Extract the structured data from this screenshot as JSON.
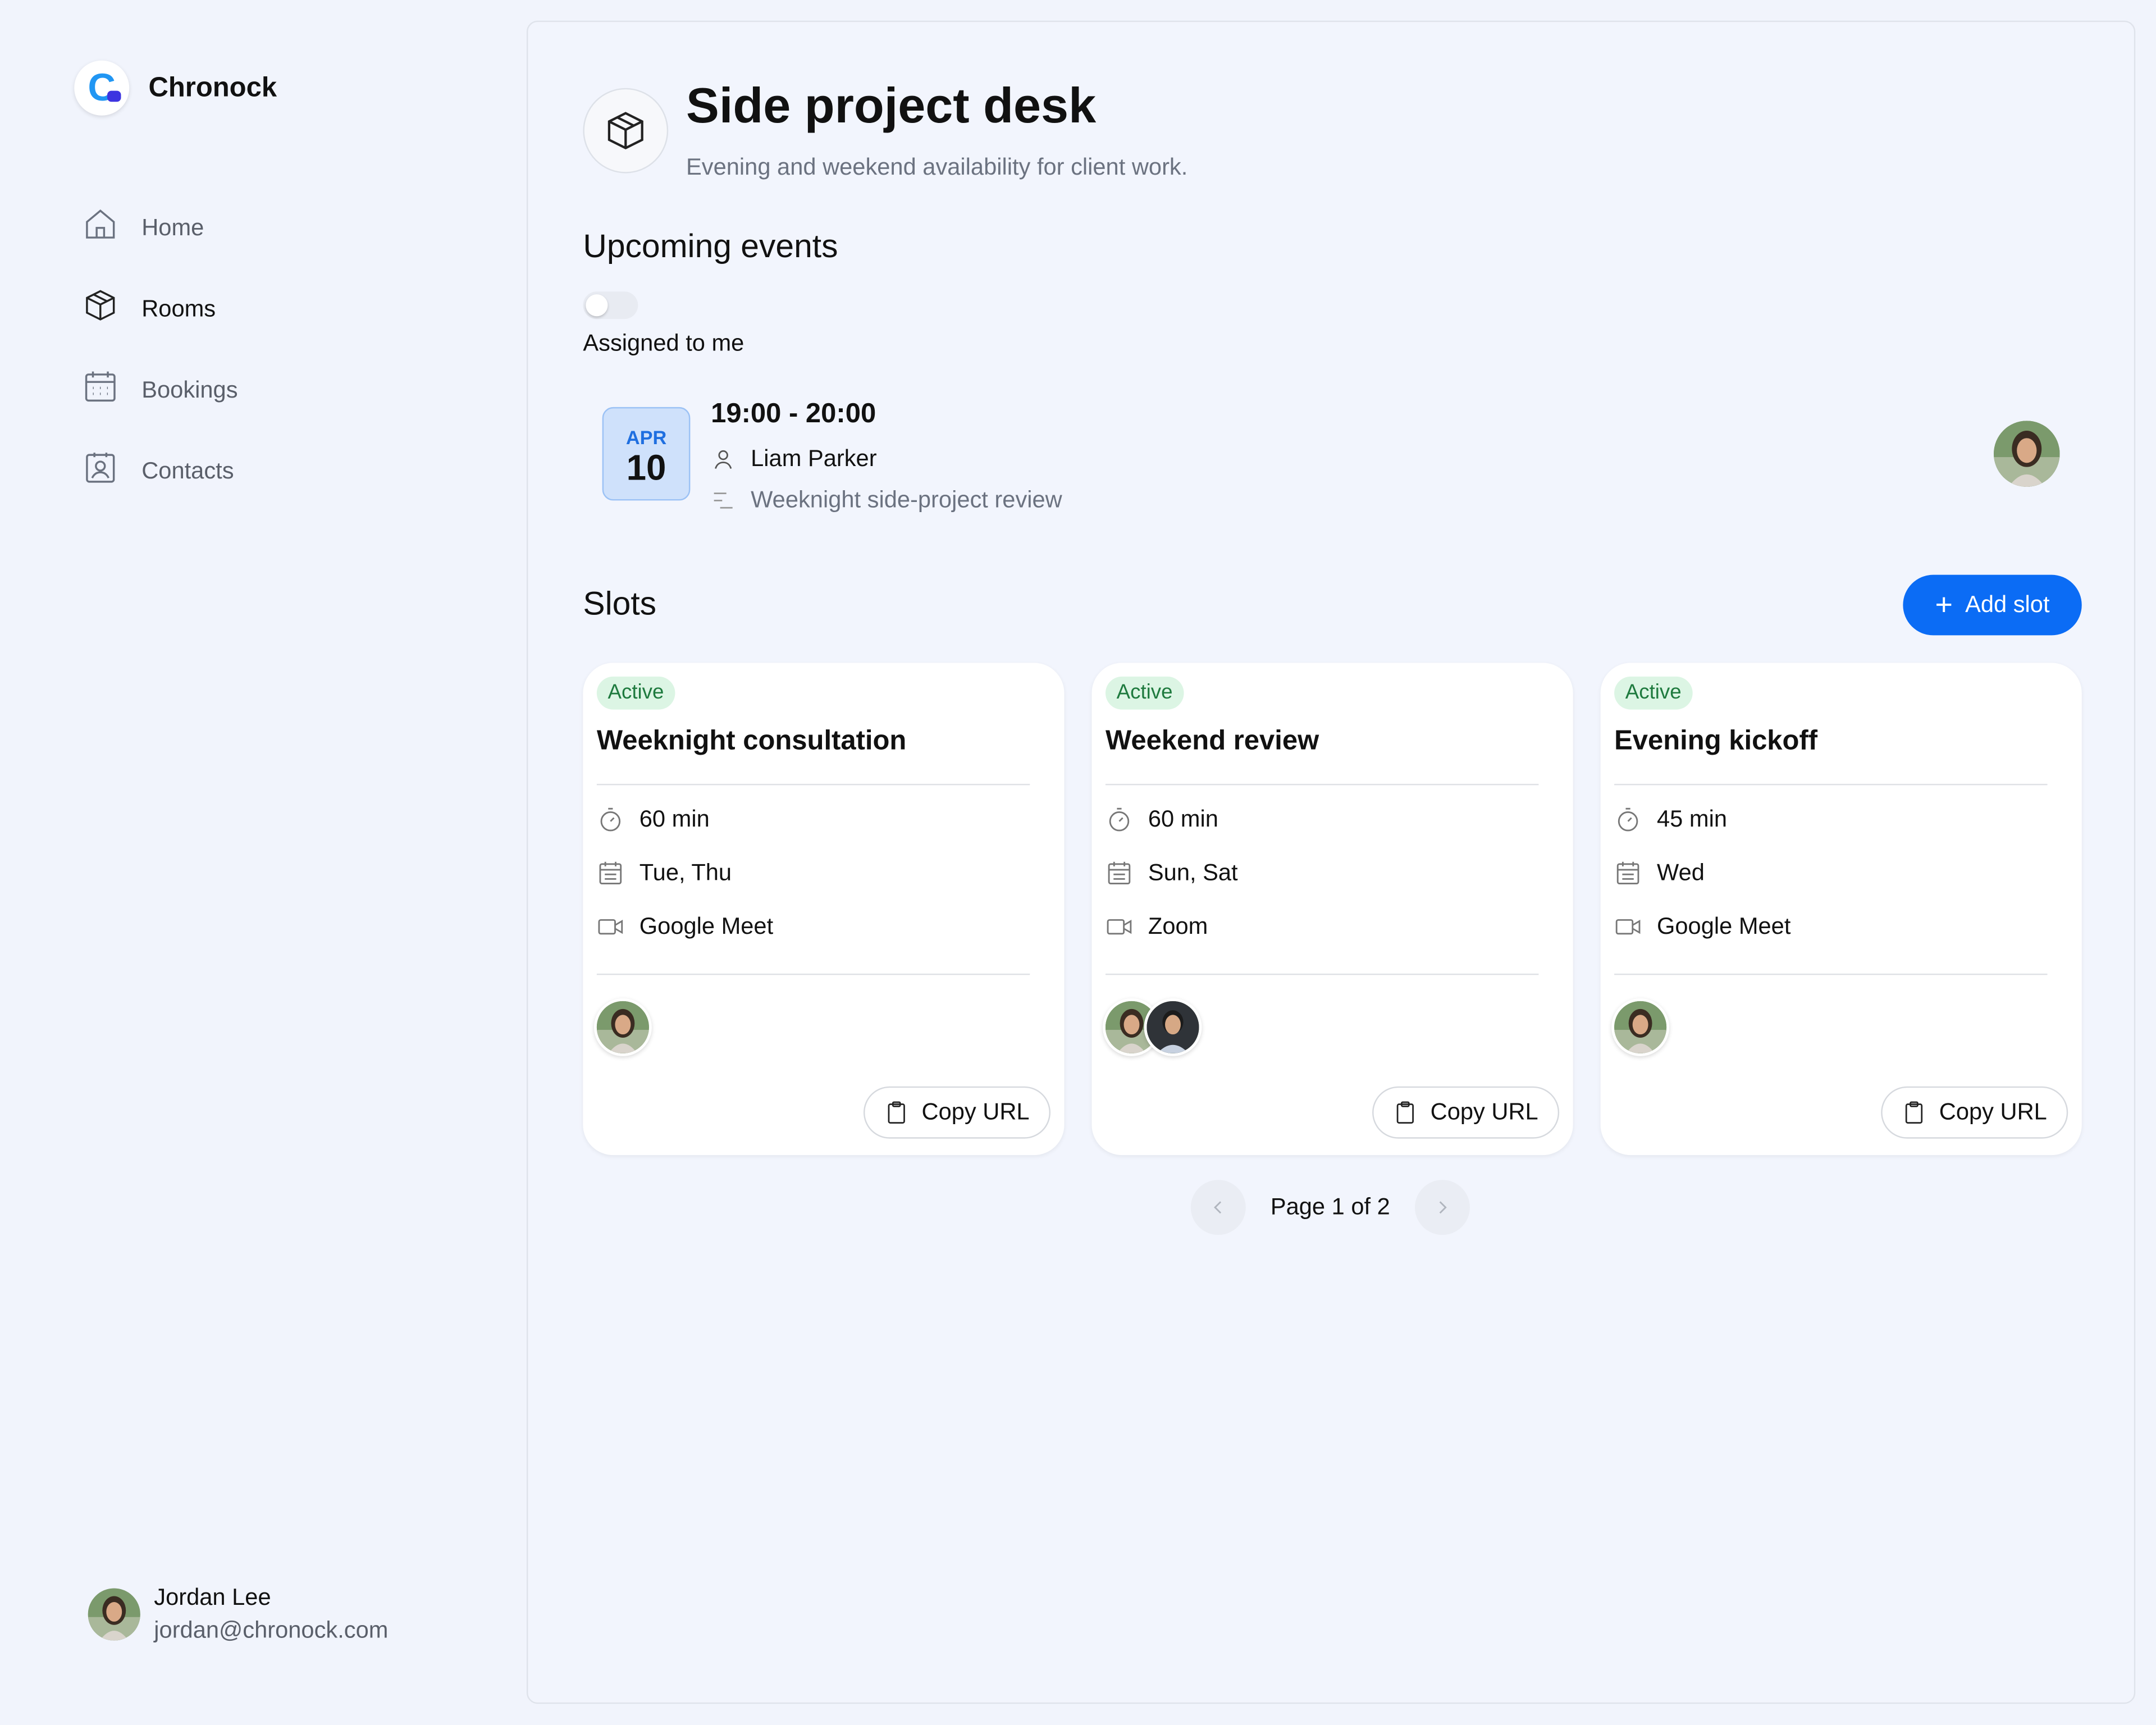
{
  "app": {
    "name": "Chronock",
    "logo_letter": "C"
  },
  "nav": {
    "items": [
      {
        "label": "Home",
        "icon": "home-icon"
      },
      {
        "label": "Rooms",
        "icon": "cube-icon",
        "active": true
      },
      {
        "label": "Bookings",
        "icon": "calendar-icon"
      },
      {
        "label": "Contacts",
        "icon": "contact-icon"
      }
    ]
  },
  "user": {
    "name": "Jordan Lee",
    "email": "jordan@chronock.com"
  },
  "page": {
    "title": "Side project desk",
    "subtitle": "Evening and weekend availability for client work."
  },
  "upcoming": {
    "title": "Upcoming events",
    "toggle_label": "Assigned to me",
    "toggle_on": false,
    "event": {
      "month": "APR",
      "day": "10",
      "time": "19:00 - 20:00",
      "person": "Liam Parker",
      "description": "Weeknight side-project review"
    }
  },
  "slots": {
    "title": "Slots",
    "add_label": "Add slot",
    "items": [
      {
        "status": "Active",
        "title": "Weeknight consultation",
        "duration": "60 min",
        "days": "Tue, Thu",
        "location": "Google Meet",
        "copy_label": "Copy URL"
      },
      {
        "status": "Active",
        "title": "Weekend review",
        "duration": "60 min",
        "days": "Sun, Sat",
        "location": "Zoom",
        "copy_label": "Copy URL"
      },
      {
        "status": "Active",
        "title": "Evening kickoff",
        "duration": "45 min",
        "days": "Wed",
        "location": "Google Meet",
        "copy_label": "Copy URL"
      }
    ]
  },
  "pagination": {
    "text": "Page 1 of 2",
    "prev_icon": "chevron-left-icon",
    "next_icon": "chevron-right-icon"
  },
  "colors": {
    "accent": "#0b6cf5",
    "active_badge_bg": "#dcf5e4",
    "active_badge_text": "#1e7a3e",
    "date_badge_bg": "#cfe1fb"
  }
}
